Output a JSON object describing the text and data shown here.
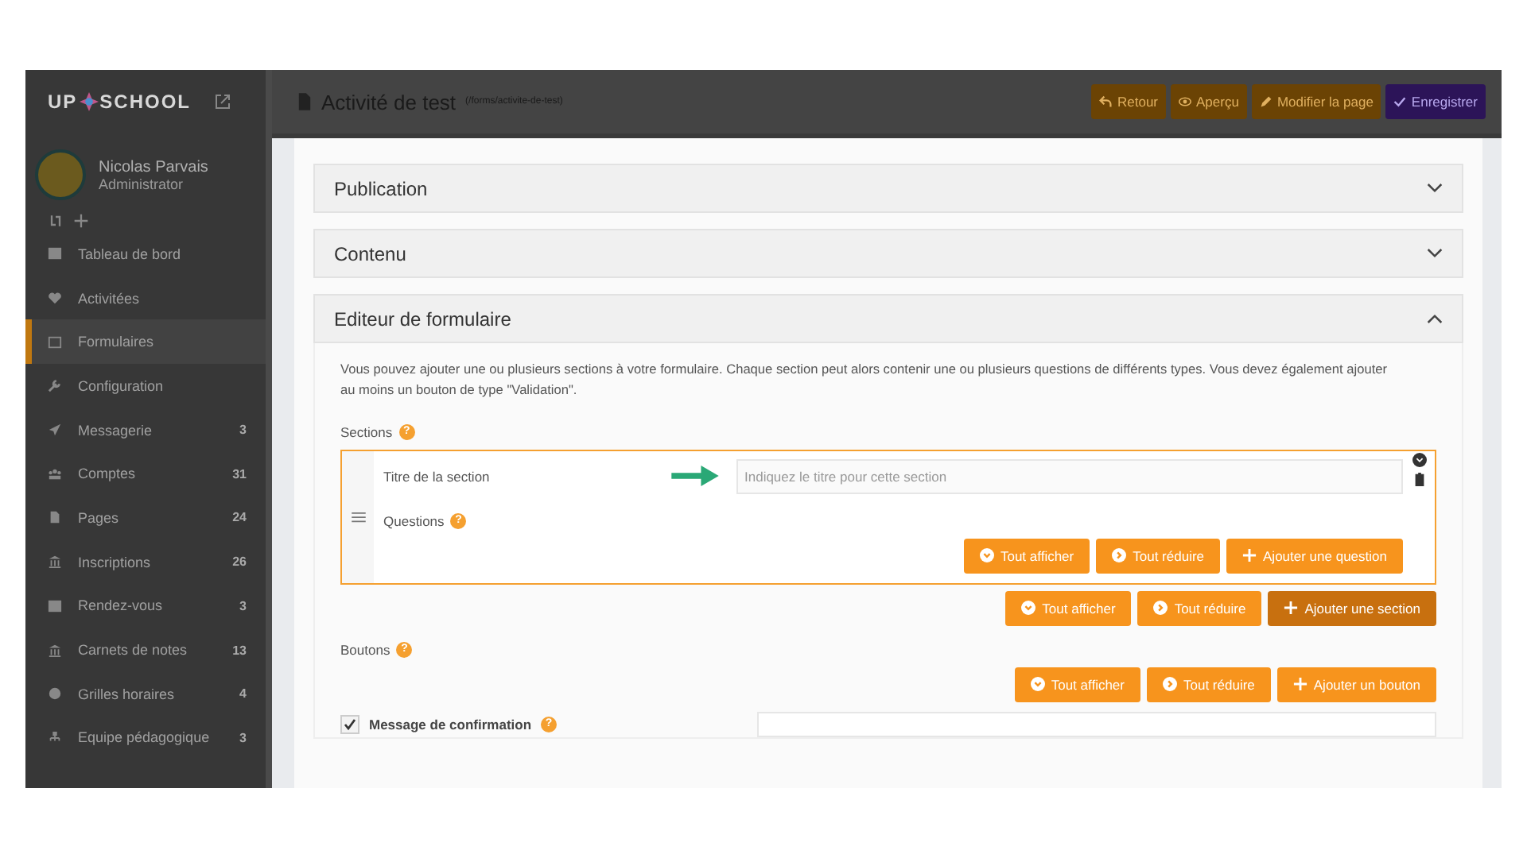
{
  "sidebar": {
    "logo_left": "UP",
    "logo_right": "SCHOOL",
    "user": {
      "name": "Nicolas Parvais",
      "role": "Administrator"
    },
    "items": [
      {
        "label": "Tableau de bord",
        "selected": false
      },
      {
        "label": "Activitées",
        "selected": false
      },
      {
        "label": "Formulaires",
        "selected": true
      },
      {
        "label": "Configuration",
        "selected": false
      },
      {
        "label": "Messagerie",
        "badge": "3",
        "selected": false
      },
      {
        "label": "Comptes",
        "badge": "31",
        "selected": false
      },
      {
        "label": "Pages",
        "badge": "24",
        "selected": false
      },
      {
        "label": "Inscriptions",
        "badge": "26",
        "selected": false
      },
      {
        "label": "Rendez-vous",
        "badge": "3",
        "selected": false
      },
      {
        "label": "Carnets de notes",
        "badge": "13",
        "selected": false
      },
      {
        "label": "Grilles horaires",
        "badge": "4",
        "selected": false
      },
      {
        "label": "Equipe pédagogique",
        "badge": "3",
        "selected": false
      }
    ]
  },
  "header": {
    "title": "Activité de test",
    "path": "(/forms/activite-de-test)",
    "buttons": [
      {
        "label": "Retour",
        "kind": "back"
      },
      {
        "label": "Aperçu",
        "kind": "eye"
      },
      {
        "label": "Modifier la page",
        "kind": "pencil"
      },
      {
        "label": "Enregistrer",
        "kind": "save"
      }
    ]
  },
  "panels": [
    {
      "title": "Publication",
      "expanded": false
    },
    {
      "title": "Contenu",
      "expanded": false
    },
    {
      "title": "Editeur de formulaire",
      "expanded": true
    }
  ],
  "editor": {
    "intro": "Vous pouvez ajouter une ou plusieurs sections à votre formulaire. Chaque section peut alors contenir une ou plusieurs questions de différents types. Vous devez également ajouter au moins un bouton de type \"Validation\".",
    "sections_label": "Sections",
    "sections_help": "?",
    "section": {
      "title_label": "Titre de la section",
      "title_placeholder": "Indiquez le titre pour cette section",
      "questions_label": "Questions",
      "questions_help": "?",
      "buttons": [
        {
          "label": "Tout afficher",
          "kind": "expand",
          "highlighted": false
        },
        {
          "label": "Tout réduire",
          "kind": "collapse",
          "highlighted": false
        },
        {
          "label": "Ajouter une question",
          "kind": "add",
          "highlighted": false
        }
      ]
    },
    "section_buttons": [
      {
        "label": "Tout afficher",
        "kind": "expand",
        "highlighted": false
      },
      {
        "label": "Tout réduire",
        "kind": "collapse",
        "highlighted": false
      },
      {
        "label": "Ajouter une section",
        "kind": "add",
        "highlighted": true
      }
    ],
    "buttons_label": "Boutons",
    "buttons_help": "?",
    "button_buttons": [
      {
        "label": "Tout afficher",
        "kind": "expand",
        "highlighted": false
      },
      {
        "label": "Tout réduire",
        "kind": "collapse",
        "highlighted": false
      },
      {
        "label": "Ajouter un bouton",
        "kind": "add",
        "highlighted": false
      }
    ],
    "confirm_label": "Message de confirmation",
    "confirm_help": "?",
    "confirm_checked": true
  }
}
